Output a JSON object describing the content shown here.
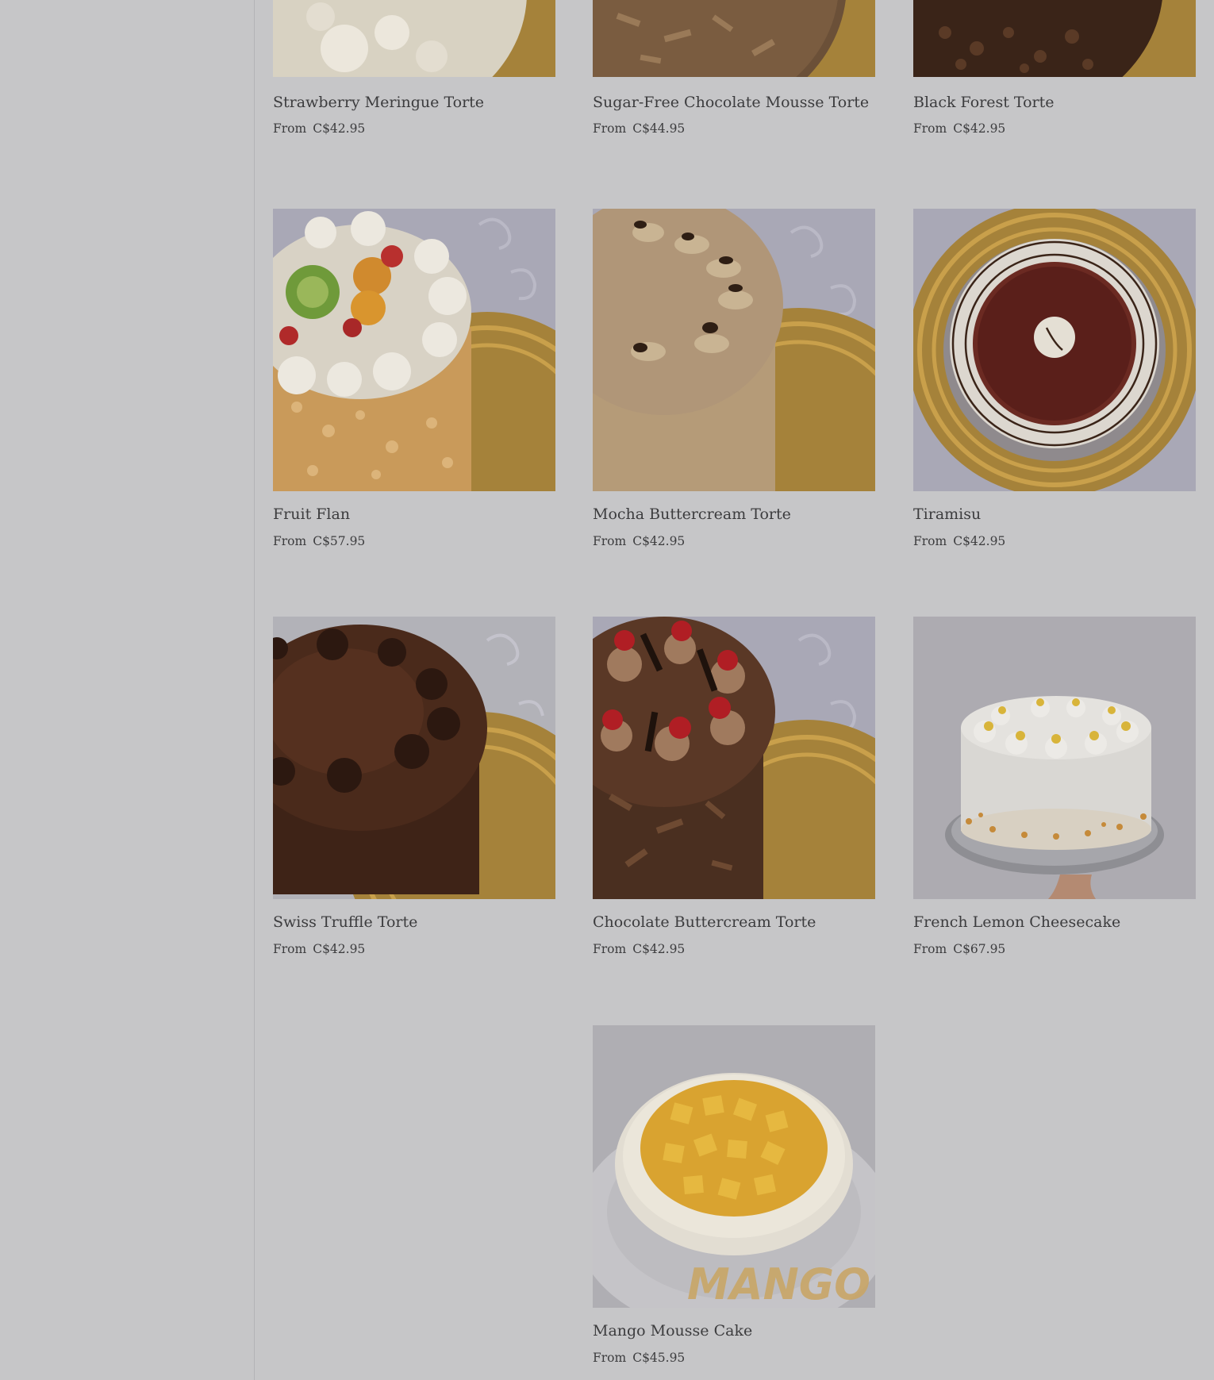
{
  "products": [
    {
      "name": "Strawberry Meringue Torte",
      "price_prefix": "From",
      "price": "C$42.95",
      "image": "strawberry-meringue-torte-image"
    },
    {
      "name": "Sugar-Free Chocolate Mousse Torte",
      "price_prefix": "From",
      "price": "C$44.95",
      "image": "sugar-free-chocolate-mousse-torte-image"
    },
    {
      "name": "Black Forest Torte",
      "price_prefix": "From",
      "price": "C$42.95",
      "image": "black-forest-torte-image"
    },
    {
      "name": "Fruit Flan",
      "price_prefix": "From",
      "price": "C$57.95",
      "image": "fruit-flan-image"
    },
    {
      "name": "Mocha Buttercream Torte",
      "price_prefix": "From",
      "price": "C$42.95",
      "image": "mocha-buttercream-torte-image"
    },
    {
      "name": "Tiramisu",
      "price_prefix": "From",
      "price": "C$42.95",
      "image": "tiramisu-image"
    },
    {
      "name": "Swiss Truffle Torte",
      "price_prefix": "From",
      "price": "C$42.95",
      "image": "swiss-truffle-torte-image"
    },
    {
      "name": "Chocolate Buttercream Torte",
      "price_prefix": "From",
      "price": "C$42.95",
      "image": "chocolate-buttercream-torte-image"
    },
    {
      "name": "French Lemon Cheesecake",
      "price_prefix": "From",
      "price": "C$67.95",
      "image": "french-lemon-cheesecake-image"
    },
    {
      "name": "Mango Mousse Cake",
      "price_prefix": "From",
      "price": "C$45.95",
      "image": "mango-mousse-cake-image",
      "image_text": "MANGO"
    }
  ],
  "colors": {
    "background": "#c6c6c8",
    "text": "#3c3c3e",
    "gold_board": "#b8923a",
    "cream": "#e9e4da"
  }
}
